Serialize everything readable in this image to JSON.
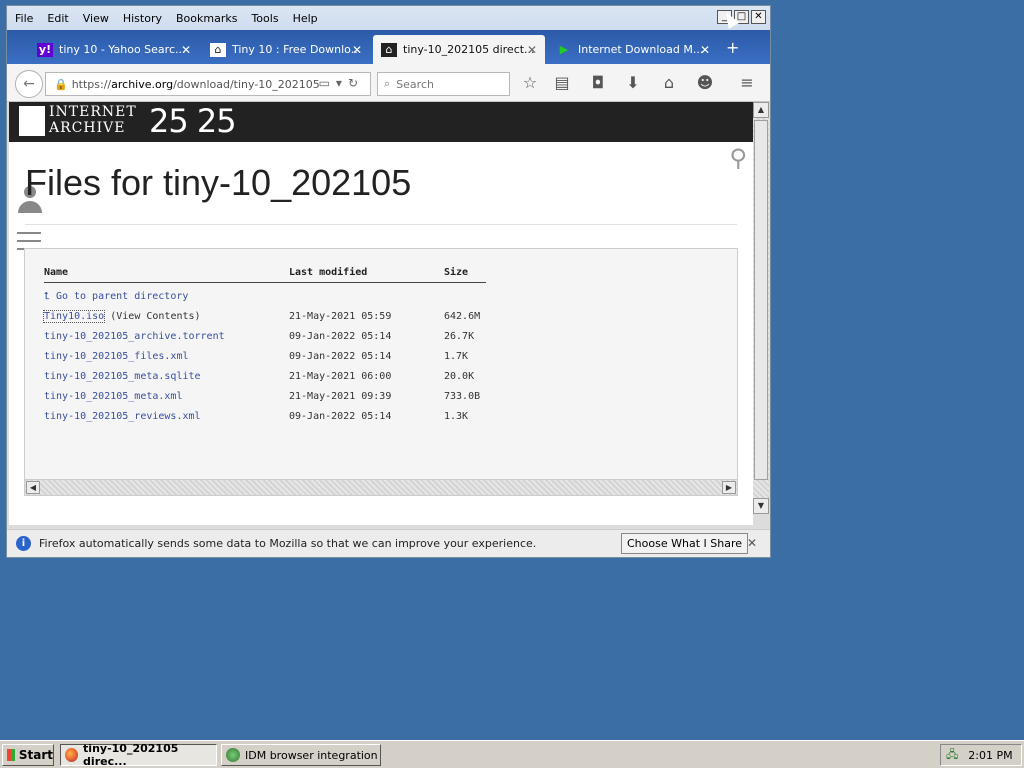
{
  "menu": [
    "File",
    "Edit",
    "View",
    "History",
    "Bookmarks",
    "Tools",
    "Help"
  ],
  "tabs": [
    {
      "label": "tiny 10 - Yahoo Searc...",
      "icon": "yahoo-icon"
    },
    {
      "label": "Tiny 10 : Free Downlo...",
      "icon": "archive-icon"
    },
    {
      "label": "tiny-10_202105 direct...",
      "icon": "archive-icon"
    },
    {
      "label": "Internet Download M...",
      "icon": "idm-icon"
    }
  ],
  "url": {
    "prefix": "https://",
    "host": "archive.org",
    "path": "/download/tiny-10_202105"
  },
  "search_placeholder": "Search",
  "ia": {
    "line1": "INTERNET",
    "line2": "ARCHIVE",
    "anniv": "25 25"
  },
  "page_title": "Files for tiny-10_202105",
  "listing": {
    "headers": {
      "name": "Name",
      "modified": "Last modified",
      "size": "Size"
    },
    "parent": "Go to parent directory",
    "files": [
      {
        "name": "Tiny10.iso",
        "extra": "(View Contents)",
        "modified": "21-May-2021 05:59",
        "size": "642.6M"
      },
      {
        "name": "tiny-10_202105_archive.torrent",
        "extra": "",
        "modified": "09-Jan-2022 05:14",
        "size": "26.7K"
      },
      {
        "name": "tiny-10_202105_files.xml",
        "extra": "",
        "modified": "09-Jan-2022 05:14",
        "size": "1.7K"
      },
      {
        "name": "tiny-10_202105_meta.sqlite",
        "extra": "",
        "modified": "21-May-2021 06:00",
        "size": "20.0K"
      },
      {
        "name": "tiny-10_202105_meta.xml",
        "extra": "",
        "modified": "21-May-2021 09:39",
        "size": "733.0B"
      },
      {
        "name": "tiny-10_202105_reviews.xml",
        "extra": "",
        "modified": "09-Jan-2022 05:14",
        "size": "1.3K"
      }
    ]
  },
  "notification": {
    "message": "Firefox automatically sends some data to Mozilla so that we can improve your experience.",
    "button": "Choose What I Share"
  },
  "taskbar": {
    "start": "Start",
    "tasks": [
      "tiny-10_202105 direc...",
      "IDM browser integration"
    ],
    "clock": "2:01 PM"
  }
}
